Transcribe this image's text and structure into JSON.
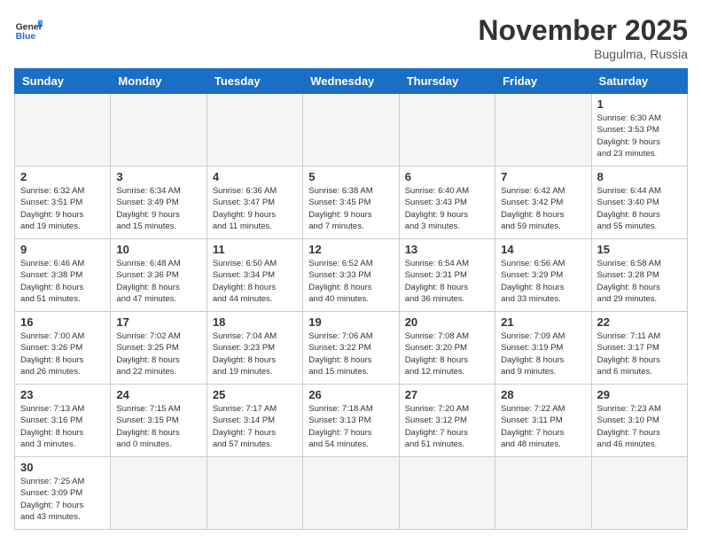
{
  "header": {
    "logo_general": "General",
    "logo_blue": "Blue",
    "month_title": "November 2025",
    "location": "Bugulma, Russia"
  },
  "days_of_week": [
    "Sunday",
    "Monday",
    "Tuesday",
    "Wednesday",
    "Thursday",
    "Friday",
    "Saturday"
  ],
  "weeks": [
    [
      {
        "day": "",
        "info": ""
      },
      {
        "day": "",
        "info": ""
      },
      {
        "day": "",
        "info": ""
      },
      {
        "day": "",
        "info": ""
      },
      {
        "day": "",
        "info": ""
      },
      {
        "day": "",
        "info": ""
      },
      {
        "day": "1",
        "info": "Sunrise: 6:30 AM\nSunset: 3:53 PM\nDaylight: 9 hours\nand 23 minutes."
      }
    ],
    [
      {
        "day": "2",
        "info": "Sunrise: 6:32 AM\nSunset: 3:51 PM\nDaylight: 9 hours\nand 19 minutes."
      },
      {
        "day": "3",
        "info": "Sunrise: 6:34 AM\nSunset: 3:49 PM\nDaylight: 9 hours\nand 15 minutes."
      },
      {
        "day": "4",
        "info": "Sunrise: 6:36 AM\nSunset: 3:47 PM\nDaylight: 9 hours\nand 11 minutes."
      },
      {
        "day": "5",
        "info": "Sunrise: 6:38 AM\nSunset: 3:45 PM\nDaylight: 9 hours\nand 7 minutes."
      },
      {
        "day": "6",
        "info": "Sunrise: 6:40 AM\nSunset: 3:43 PM\nDaylight: 9 hours\nand 3 minutes."
      },
      {
        "day": "7",
        "info": "Sunrise: 6:42 AM\nSunset: 3:42 PM\nDaylight: 8 hours\nand 59 minutes."
      },
      {
        "day": "8",
        "info": "Sunrise: 6:44 AM\nSunset: 3:40 PM\nDaylight: 8 hours\nand 55 minutes."
      }
    ],
    [
      {
        "day": "9",
        "info": "Sunrise: 6:46 AM\nSunset: 3:38 PM\nDaylight: 8 hours\nand 51 minutes."
      },
      {
        "day": "10",
        "info": "Sunrise: 6:48 AM\nSunset: 3:36 PM\nDaylight: 8 hours\nand 47 minutes."
      },
      {
        "day": "11",
        "info": "Sunrise: 6:50 AM\nSunset: 3:34 PM\nDaylight: 8 hours\nand 44 minutes."
      },
      {
        "day": "12",
        "info": "Sunrise: 6:52 AM\nSunset: 3:33 PM\nDaylight: 8 hours\nand 40 minutes."
      },
      {
        "day": "13",
        "info": "Sunrise: 6:54 AM\nSunset: 3:31 PM\nDaylight: 8 hours\nand 36 minutes."
      },
      {
        "day": "14",
        "info": "Sunrise: 6:56 AM\nSunset: 3:29 PM\nDaylight: 8 hours\nand 33 minutes."
      },
      {
        "day": "15",
        "info": "Sunrise: 6:58 AM\nSunset: 3:28 PM\nDaylight: 8 hours\nand 29 minutes."
      }
    ],
    [
      {
        "day": "16",
        "info": "Sunrise: 7:00 AM\nSunset: 3:26 PM\nDaylight: 8 hours\nand 26 minutes."
      },
      {
        "day": "17",
        "info": "Sunrise: 7:02 AM\nSunset: 3:25 PM\nDaylight: 8 hours\nand 22 minutes."
      },
      {
        "day": "18",
        "info": "Sunrise: 7:04 AM\nSunset: 3:23 PM\nDaylight: 8 hours\nand 19 minutes."
      },
      {
        "day": "19",
        "info": "Sunrise: 7:06 AM\nSunset: 3:22 PM\nDaylight: 8 hours\nand 15 minutes."
      },
      {
        "day": "20",
        "info": "Sunrise: 7:08 AM\nSunset: 3:20 PM\nDaylight: 8 hours\nand 12 minutes."
      },
      {
        "day": "21",
        "info": "Sunrise: 7:09 AM\nSunset: 3:19 PM\nDaylight: 8 hours\nand 9 minutes."
      },
      {
        "day": "22",
        "info": "Sunrise: 7:11 AM\nSunset: 3:17 PM\nDaylight: 8 hours\nand 6 minutes."
      }
    ],
    [
      {
        "day": "23",
        "info": "Sunrise: 7:13 AM\nSunset: 3:16 PM\nDaylight: 8 hours\nand 3 minutes."
      },
      {
        "day": "24",
        "info": "Sunrise: 7:15 AM\nSunset: 3:15 PM\nDaylight: 8 hours\nand 0 minutes."
      },
      {
        "day": "25",
        "info": "Sunrise: 7:17 AM\nSunset: 3:14 PM\nDaylight: 7 hours\nand 57 minutes."
      },
      {
        "day": "26",
        "info": "Sunrise: 7:18 AM\nSunset: 3:13 PM\nDaylight: 7 hours\nand 54 minutes."
      },
      {
        "day": "27",
        "info": "Sunrise: 7:20 AM\nSunset: 3:12 PM\nDaylight: 7 hours\nand 51 minutes."
      },
      {
        "day": "28",
        "info": "Sunrise: 7:22 AM\nSunset: 3:11 PM\nDaylight: 7 hours\nand 48 minutes."
      },
      {
        "day": "29",
        "info": "Sunrise: 7:23 AM\nSunset: 3:10 PM\nDaylight: 7 hours\nand 46 minutes."
      }
    ],
    [
      {
        "day": "30",
        "info": "Sunrise: 7:25 AM\nSunset: 3:09 PM\nDaylight: 7 hours\nand 43 minutes."
      },
      {
        "day": "",
        "info": ""
      },
      {
        "day": "",
        "info": ""
      },
      {
        "day": "",
        "info": ""
      },
      {
        "day": "",
        "info": ""
      },
      {
        "day": "",
        "info": ""
      },
      {
        "day": "",
        "info": ""
      }
    ]
  ]
}
